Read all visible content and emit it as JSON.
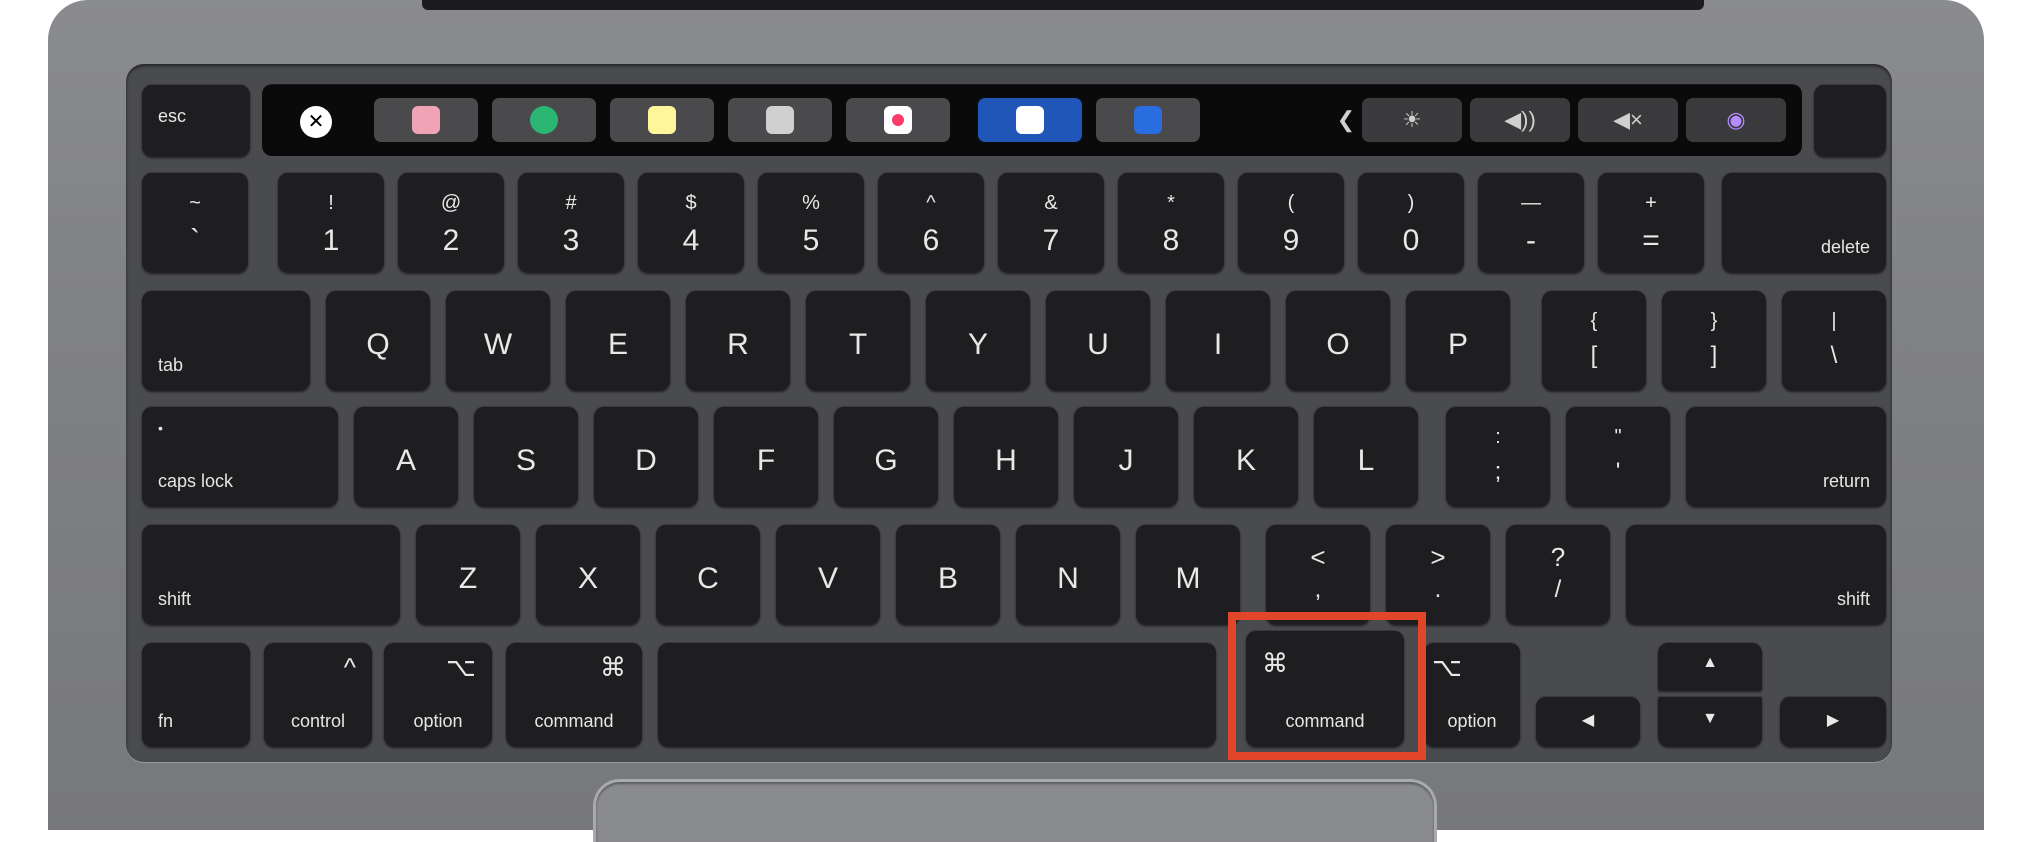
{
  "touch_bar": {
    "apps": [
      {
        "name": "close-icon",
        "color": "#ffffff"
      },
      {
        "name": "calendar-app-icon",
        "color": "#f0a3b4"
      },
      {
        "name": "maps-app-icon",
        "color": "#2bb673"
      },
      {
        "name": "notes-app-icon",
        "color": "#fff59a"
      },
      {
        "name": "preview-app-icon",
        "color": "#d0d0d0"
      },
      {
        "name": "photos-app-icon",
        "color": "#ff3b6b"
      },
      {
        "name": "keynote-app-icon",
        "color": "#1f56b8"
      },
      {
        "name": "screen-app-icon",
        "color": "#2a6de0"
      }
    ],
    "controls": {
      "collapse": "❮",
      "brightness": "☀",
      "volume": "◀))",
      "mute": "◀×",
      "siri": "◉"
    }
  },
  "keys": {
    "esc": "esc",
    "number_row": [
      {
        "top": "~",
        "bottom": "`"
      },
      {
        "top": "!",
        "bottom": "1"
      },
      {
        "top": "@",
        "bottom": "2"
      },
      {
        "top": "#",
        "bottom": "3"
      },
      {
        "top": "$",
        "bottom": "4"
      },
      {
        "top": "%",
        "bottom": "5"
      },
      {
        "top": "^",
        "bottom": "6"
      },
      {
        "top": "&",
        "bottom": "7"
      },
      {
        "top": "*",
        "bottom": "8"
      },
      {
        "top": "(",
        "bottom": "9"
      },
      {
        "top": ")",
        "bottom": "0"
      },
      {
        "top": "—",
        "bottom": "-"
      },
      {
        "top": "+",
        "bottom": "="
      }
    ],
    "delete": "delete",
    "tab": "tab",
    "qwerty_row": [
      "Q",
      "W",
      "E",
      "R",
      "T",
      "Y",
      "U",
      "I",
      "O",
      "P"
    ],
    "bracket_left": {
      "top": "{",
      "bottom": "["
    },
    "bracket_right": {
      "top": "}",
      "bottom": "]"
    },
    "backslash": {
      "top": "|",
      "bottom": "\\"
    },
    "caps_lock": {
      "top": "•",
      "bottom": "caps lock"
    },
    "home_row": [
      "A",
      "S",
      "D",
      "F",
      "G",
      "H",
      "J",
      "K",
      "L"
    ],
    "semicolon": {
      "top": ":",
      "bottom": ";"
    },
    "quote": {
      "top": "\"",
      "bottom": "'"
    },
    "return": "return",
    "shift_left": "shift",
    "bottom_row": [
      "Z",
      "X",
      "C",
      "V",
      "B",
      "N",
      "M"
    ],
    "comma": {
      "top": "<",
      "bottom": ","
    },
    "period": {
      "top": ">",
      "bottom": "."
    },
    "slash": {
      "top": "?",
      "bottom": "/"
    },
    "shift_right": "shift",
    "fn": "fn",
    "control": {
      "symbol": "^",
      "label": "control"
    },
    "option_left": {
      "symbol": "⌥",
      "label": "option"
    },
    "command_left": {
      "symbol": "⌘",
      "label": "command"
    },
    "command_right": {
      "symbol": "⌘",
      "label": "command"
    },
    "option_right": {
      "symbol": "⌥",
      "label": "option"
    },
    "arrows": {
      "left": "◀",
      "right": "▶",
      "up": "▲",
      "down": "▼"
    }
  },
  "highlight_color": "#e1452a"
}
